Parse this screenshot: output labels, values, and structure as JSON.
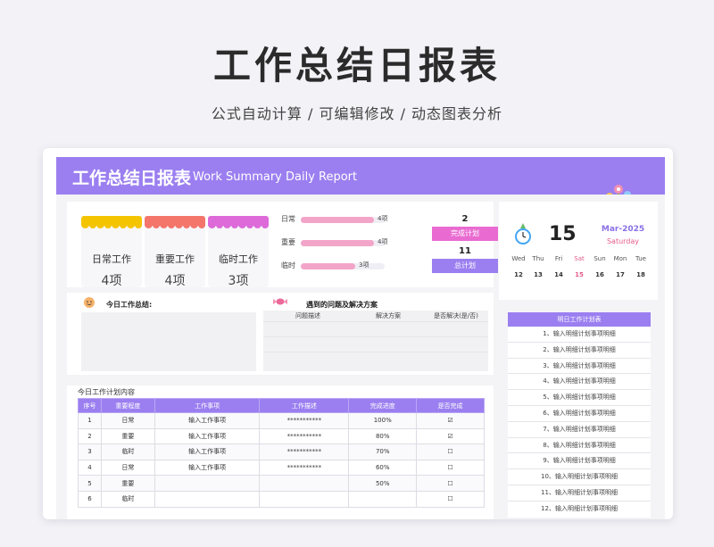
{
  "promo": {
    "title": "工作总结日报表",
    "subtitle": "公式自动计算 /  可编辑修改  / 动态图表分析"
  },
  "header": {
    "title": "工作总结日报表",
    "title_en": "Work Summary Daily Report"
  },
  "categories": [
    {
      "label": "日常工作",
      "value": "4项",
      "color": "#f5c400"
    },
    {
      "label": "重要工作",
      "value": "4项",
      "color": "#f4766a"
    },
    {
      "label": "临时工作",
      "value": "3项",
      "color": "#dd6ad8"
    }
  ],
  "category_bars": [
    {
      "label": "日常",
      "value_label": "4项",
      "value": 4
    },
    {
      "label": "重要",
      "value_label": "4项",
      "value": 4
    },
    {
      "label": "临时",
      "value_label": "3项",
      "value": 3
    }
  ],
  "stats": {
    "completed_count": "2",
    "completed_label": "完成计划",
    "total_count": "11",
    "total_label": "总计划"
  },
  "calendar": {
    "day": "15",
    "month": "Mar-2025",
    "weekday": "Saturday",
    "weekdays": [
      "Wed",
      "Thu",
      "Fri",
      "Sat",
      "Sun",
      "Mon",
      "Tue"
    ],
    "dates": [
      "12",
      "13",
      "14",
      "15",
      "16",
      "17",
      "18"
    ],
    "highlight_index": 3
  },
  "summary": {
    "title": "今日工作总结:"
  },
  "problems": {
    "title": "遇到的问题及解决方案",
    "columns": [
      "问题描述",
      "解决方案",
      "是否解决(是/否)"
    ]
  },
  "plan": {
    "title": "今日工作计划内容",
    "columns": [
      "序号",
      "重要程度",
      "工作事项",
      "工作描述",
      "完成进度",
      "是否完成"
    ],
    "rows": [
      {
        "no": "1",
        "level": "日常",
        "item": "输入工作事项",
        "desc": "***********",
        "progress": "100%",
        "done": "☑"
      },
      {
        "no": "2",
        "level": "重要",
        "item": "输入工作事项",
        "desc": "***********",
        "progress": "80%",
        "done": "☑"
      },
      {
        "no": "3",
        "level": "临时",
        "item": "输入工作事项",
        "desc": "***********",
        "progress": "70%",
        "done": "☐"
      },
      {
        "no": "4",
        "level": "日常",
        "item": "输入工作事项",
        "desc": "***********",
        "progress": "60%",
        "done": "☐"
      },
      {
        "no": "5",
        "level": "重要",
        "item": "",
        "desc": "",
        "progress": "50%",
        "done": "☐"
      },
      {
        "no": "6",
        "level": "临时",
        "item": "",
        "desc": "",
        "progress": "",
        "done": "☐"
      }
    ]
  },
  "tomorrow": {
    "title": "明日工作计划表",
    "items": [
      "1、输入明细计划事项明细",
      "2、输入明细计划事项明细",
      "3、输入明细计划事项明细",
      "4、输入明细计划事项明细",
      "5、输入明细计划事项明细",
      "6、输入明细计划事项明细",
      "7、输入明细计划事项明细",
      "8、输入明细计划事项明细",
      "9、输入明细计划事项明细",
      "10、输入明细计划事项明细",
      "11、输入明细计划事项明细",
      "12、输入明细计划事项明细"
    ]
  },
  "colors": {
    "accent": "#9b7ff0",
    "pink_button": "#e96bd1",
    "bar_fill": "#f3a5c9"
  }
}
